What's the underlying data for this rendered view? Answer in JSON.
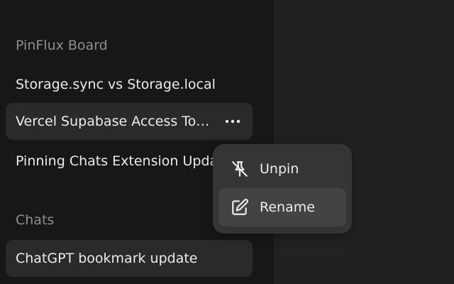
{
  "sidebar": {
    "pinned_section_label": "PinFlux Board",
    "pinned_items": [
      {
        "label": "Storage.sync vs Storage.local"
      },
      {
        "label": "Vercel Supabase Access Tokens"
      },
      {
        "label": "Pinning Chats Extension Update"
      }
    ],
    "chats_section_label": "Chats",
    "chat_items": [
      {
        "label": "ChatGPT bookmark update"
      }
    ]
  },
  "context_menu": {
    "items": [
      {
        "label": "Unpin",
        "icon": "unpin-icon"
      },
      {
        "label": "Rename",
        "icon": "edit-icon"
      }
    ]
  },
  "colors": {
    "sidebar_bg": "#171717",
    "main_bg": "#212121",
    "menu_bg": "#353535",
    "text": "#ececec",
    "muted_text": "#8f8f8f"
  }
}
